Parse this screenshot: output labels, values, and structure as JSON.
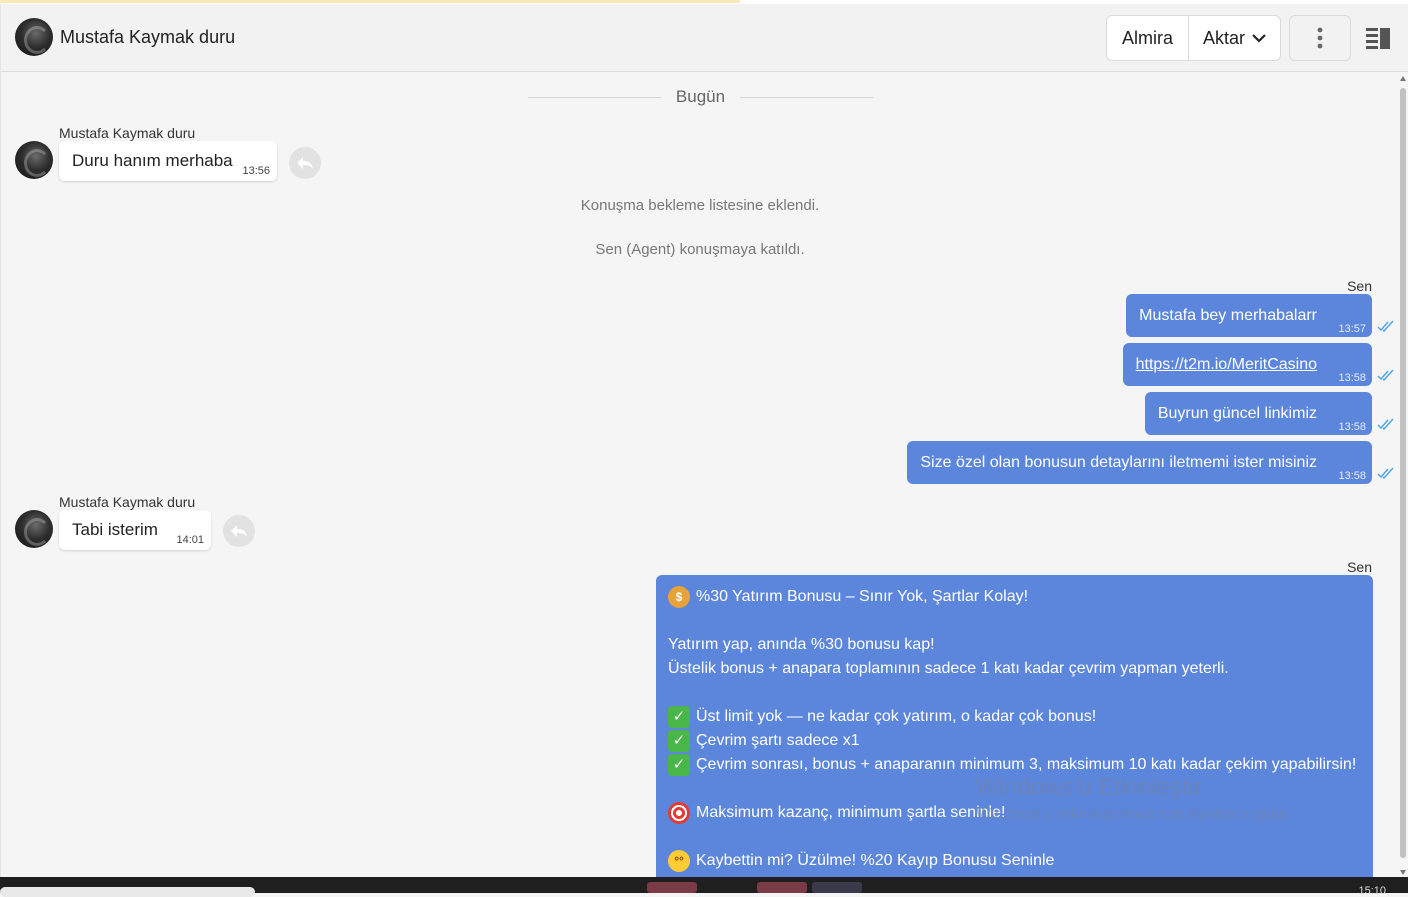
{
  "header": {
    "contact_name": "Mustafa Kaymak duru",
    "almira_label": "Almira",
    "aktar_label": "Aktar"
  },
  "chat": {
    "day_separator": "Bugün",
    "incoming_1": {
      "sender": "Mustafa Kaymak duru",
      "text": "Duru hanım merhaba",
      "time": "13:56"
    },
    "system_1": "Konuşma bekleme listesine eklendi.",
    "system_2": "Sen (Agent) konuşmaya katıldı.",
    "outgoing_sender": "Sen",
    "outgoing": [
      {
        "text": "Mustafa bey merhabalarr",
        "time": "13:57"
      },
      {
        "text": "https://t2m.io/MeritCasino",
        "time": "13:58"
      },
      {
        "text": "Buyrun güncel linkimiz",
        "time": "13:58"
      },
      {
        "text": "Size özel olan bonusun detaylarını iletmemi ister misiniz",
        "time": "13:58"
      }
    ],
    "incoming_2": {
      "sender": "Mustafa Kaymak duru",
      "text": "Tabi isterim",
      "time": "14:01"
    },
    "outgoing_sender_2": "Sen",
    "bonus_message": {
      "title": "%30 Yatırım Bonusu – Sınır Yok, Şartlar Kolay!",
      "line_1": "Yatırım yap, anında %30 bonusu kap!",
      "line_2": "Üstelik bonus + anapara toplamının sadece 1 katı kadar çevrim yapman yeterli.",
      "bullet_1": "Üst limit yok — ne kadar çok yatırım, o kadar çok bonus!",
      "bullet_2": "Çevrim şartı sadece x1",
      "bullet_3": "Çevrim sonrası, bonus + anaparanın minimum 3, maksimum 10 katı kadar çekim yapabilirsin!",
      "max_line": "Maksimum kazanç, minimum şartla seninle!",
      "lose_line": "Kaybettin mi? Üzülme! %20 Kayıp Bonusu Seninle"
    }
  },
  "watermark": {
    "title": "Windows'u Etkinleştir",
    "subtitle": "Windows'u etkinleştirmek için Ayarlar'a gidin."
  },
  "taskbar": {
    "clock": "15:10"
  },
  "colors": {
    "outgoing_bubble": "#5b86dc",
    "background": "#f5f5f5",
    "read_tick": "#4aa3e8"
  },
  "icons": [
    "avatar",
    "chevron-down-icon",
    "more-vertical-icon",
    "side-panel-icon",
    "reply-icon",
    "double-check-icon",
    "money-bag-emoji",
    "check-mark-emoji",
    "dart-emoji",
    "flushed-face-emoji"
  ]
}
